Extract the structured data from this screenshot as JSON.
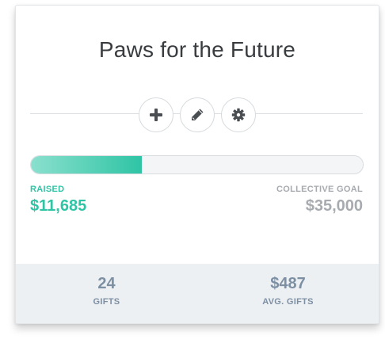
{
  "campaign": {
    "title": "Paws for the Future"
  },
  "actions": [
    {
      "name": "add",
      "icon": "plus-icon"
    },
    {
      "name": "edit",
      "icon": "pencil-icon"
    },
    {
      "name": "settings",
      "icon": "gear-icon"
    }
  ],
  "progress": {
    "fraction": 0.334,
    "fill_color_start": "#8ae0cd",
    "fill_color_end": "#2fc4a5"
  },
  "raised": {
    "label": "RAISED",
    "value": "$11,685"
  },
  "goal": {
    "label": "COLLECTIVE GOAL",
    "value": "$35,000"
  },
  "footer": {
    "gifts_value": "24",
    "gifts_label": "GIFTS",
    "avg_value": "$487",
    "avg_label": "AVG. GIFTS"
  },
  "colors": {
    "accent": "#2fc4a5",
    "muted": "#a7abb0",
    "footer_text": "#7d8fa3",
    "footer_bg": "#ecf0f3"
  }
}
